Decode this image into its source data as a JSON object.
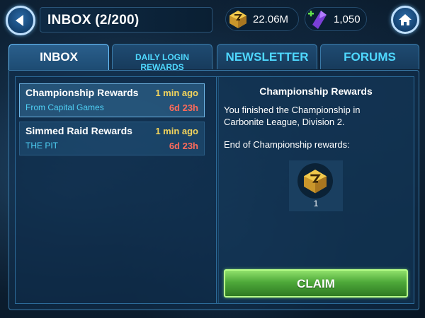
{
  "header": {
    "title": "INBOX (2/200)",
    "credits": {
      "icon": "credits-icon",
      "value": "22.06M"
    },
    "crystals": {
      "icon": "crystal-icon",
      "value": "1,050"
    },
    "back_icon": "back-arrow-icon",
    "home_icon": "home-icon"
  },
  "tabs": [
    {
      "label": "INBOX",
      "active": true
    },
    {
      "label": "DAILY LOGIN REWARDS",
      "active": false
    },
    {
      "label": "NEWSLETTER",
      "active": false
    },
    {
      "label": "FORUMS",
      "active": false
    }
  ],
  "messages": [
    {
      "title": "Championship Rewards",
      "time": "1 min ago",
      "sender": "From Capital Games",
      "expires": "6d 23h",
      "selected": true
    },
    {
      "title": "Simmed Raid Rewards",
      "time": "1 min ago",
      "sender": "THE PIT",
      "expires": "6d 23h",
      "selected": false
    }
  ],
  "detail": {
    "title": "Championship Rewards",
    "body": "You finished the Championship in\nCarbonite League, Division 2.",
    "subheading": "End of Championship rewards:",
    "reward": {
      "icon": "credits-icon",
      "quantity": "1"
    },
    "claim_label": "CLAIM"
  },
  "colors": {
    "accent_cyan": "#4fd8ff",
    "time_yellow": "#f3d45c",
    "expire_red": "#ff6b5a",
    "claim_green": "#4ea93a"
  }
}
